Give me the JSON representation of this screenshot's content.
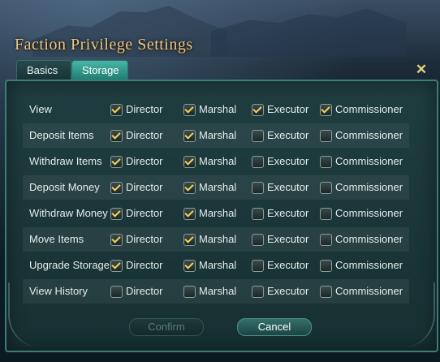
{
  "dialog": {
    "title": "Faction Privilege Settings",
    "close_icon": "close-icon"
  },
  "tabs": [
    {
      "label": "Basics",
      "selected": false
    },
    {
      "label": "Storage",
      "selected": true
    }
  ],
  "rows": [
    {
      "label": "View",
      "options": [
        {
          "label": "Director",
          "checked": true
        },
        {
          "label": "Marshal",
          "checked": true
        },
        {
          "label": "Executor",
          "checked": true
        },
        {
          "label": "Commissioner",
          "checked": true
        }
      ]
    },
    {
      "label": "Deposit Items",
      "options": [
        {
          "label": "Director",
          "checked": true
        },
        {
          "label": "Marshal",
          "checked": true
        },
        {
          "label": "Executor",
          "checked": false
        },
        {
          "label": "Commissioner",
          "checked": false
        }
      ]
    },
    {
      "label": "Withdraw Items",
      "options": [
        {
          "label": "Director",
          "checked": true
        },
        {
          "label": "Marshal",
          "checked": true
        },
        {
          "label": "Executor",
          "checked": false
        },
        {
          "label": "Commissioner",
          "checked": false
        }
      ]
    },
    {
      "label": "Deposit Money",
      "options": [
        {
          "label": "Director",
          "checked": true
        },
        {
          "label": "Marshal",
          "checked": true
        },
        {
          "label": "Executor",
          "checked": false
        },
        {
          "label": "Commissioner",
          "checked": false
        }
      ]
    },
    {
      "label": "Withdraw Money",
      "options": [
        {
          "label": "Director",
          "checked": true
        },
        {
          "label": "Marshal",
          "checked": true
        },
        {
          "label": "Executor",
          "checked": false
        },
        {
          "label": "Commissioner",
          "checked": false
        }
      ]
    },
    {
      "label": "Move Items",
      "options": [
        {
          "label": "Director",
          "checked": true
        },
        {
          "label": "Marshal",
          "checked": true
        },
        {
          "label": "Executor",
          "checked": false
        },
        {
          "label": "Commissioner",
          "checked": false
        }
      ]
    },
    {
      "label": "Upgrade Storage",
      "options": [
        {
          "label": "Director",
          "checked": true
        },
        {
          "label": "Marshal",
          "checked": true
        },
        {
          "label": "Executor",
          "checked": false
        },
        {
          "label": "Commissioner",
          "checked": false
        }
      ]
    },
    {
      "label": "View History",
      "options": [
        {
          "label": "Director",
          "checked": false
        },
        {
          "label": "Marshal",
          "checked": false
        },
        {
          "label": "Executor",
          "checked": false
        },
        {
          "label": "Commissioner",
          "checked": false
        }
      ]
    }
  ],
  "buttons": {
    "confirm": {
      "label": "Confirm",
      "enabled": false
    },
    "cancel": {
      "label": "Cancel",
      "enabled": true
    }
  },
  "colors": {
    "title": "#e8c98d",
    "checkmark": "#f5d25a",
    "active_tab": "#2fa596"
  }
}
